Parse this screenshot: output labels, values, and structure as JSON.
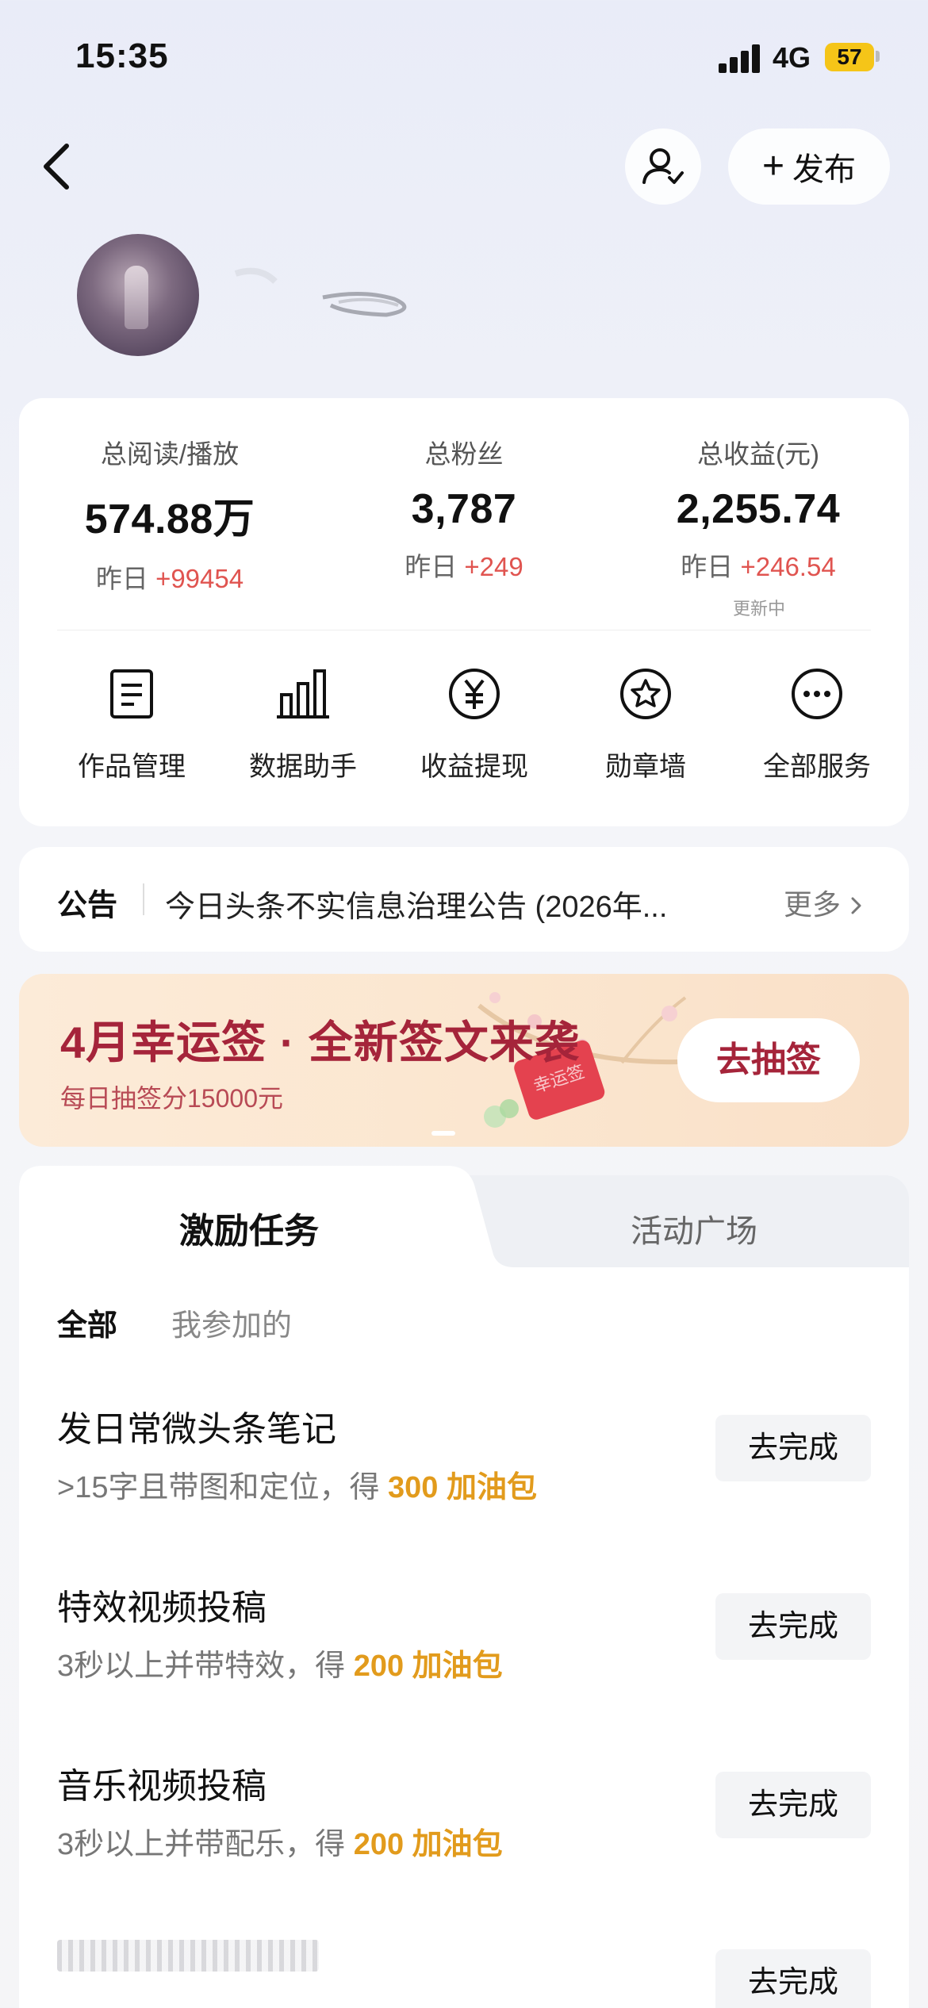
{
  "status_bar": {
    "time": "15:35",
    "network": "4G",
    "battery": "57"
  },
  "nav": {
    "publish_label": "发布"
  },
  "stats": [
    {
      "label": "总阅读/播放",
      "value": "574.88万",
      "delta_prefix": "昨日",
      "delta": "+99454"
    },
    {
      "label": "总粉丝",
      "value": "3,787",
      "delta_prefix": "昨日",
      "delta": "+249"
    },
    {
      "label": "总收益(元)",
      "value": "2,255.74",
      "delta_prefix": "昨日",
      "delta": "+246.54"
    }
  ],
  "updating_label": "更新中",
  "services": [
    {
      "label": "作品管理",
      "icon": "document-icon"
    },
    {
      "label": "数据助手",
      "icon": "bar-chart-icon"
    },
    {
      "label": "收益提现",
      "icon": "yuan-icon"
    },
    {
      "label": "勋章墙",
      "icon": "medal-icon"
    },
    {
      "label": "全部服务",
      "icon": "more-icon"
    }
  ],
  "notice": {
    "title": "公告",
    "text": "今日头条不实信息治理公告 (2026年...",
    "more": "更多"
  },
  "banner": {
    "title": "4月幸运签 · 全新签文来袭",
    "subtitle": "每日抽签分15000元",
    "button": "去抽签"
  },
  "tabs": {
    "active": "激励任务",
    "inactive": "活动广场"
  },
  "filters": {
    "all": "全部",
    "mine": "我参加的"
  },
  "tasks": [
    {
      "title": "发日常微头条笔记",
      "desc_prefix": ">15字且带图和定位，得 ",
      "reward": "300 加油包",
      "button": "去完成"
    },
    {
      "title": "特效视频投稿",
      "desc_prefix": "3秒以上并带特效，得 ",
      "reward": "200 加油包",
      "button": "去完成"
    },
    {
      "title": "音乐视频投稿",
      "desc_prefix": "3秒以上并带配乐，得 ",
      "reward": "200 加油包",
      "button": "去完成"
    },
    {
      "button": "去完成"
    }
  ],
  "colors": {
    "accent_red": "#e05450",
    "reward_orange": "#e29b1c",
    "banner_red": "#a5243a",
    "battery_yellow": "#f5c518"
  }
}
